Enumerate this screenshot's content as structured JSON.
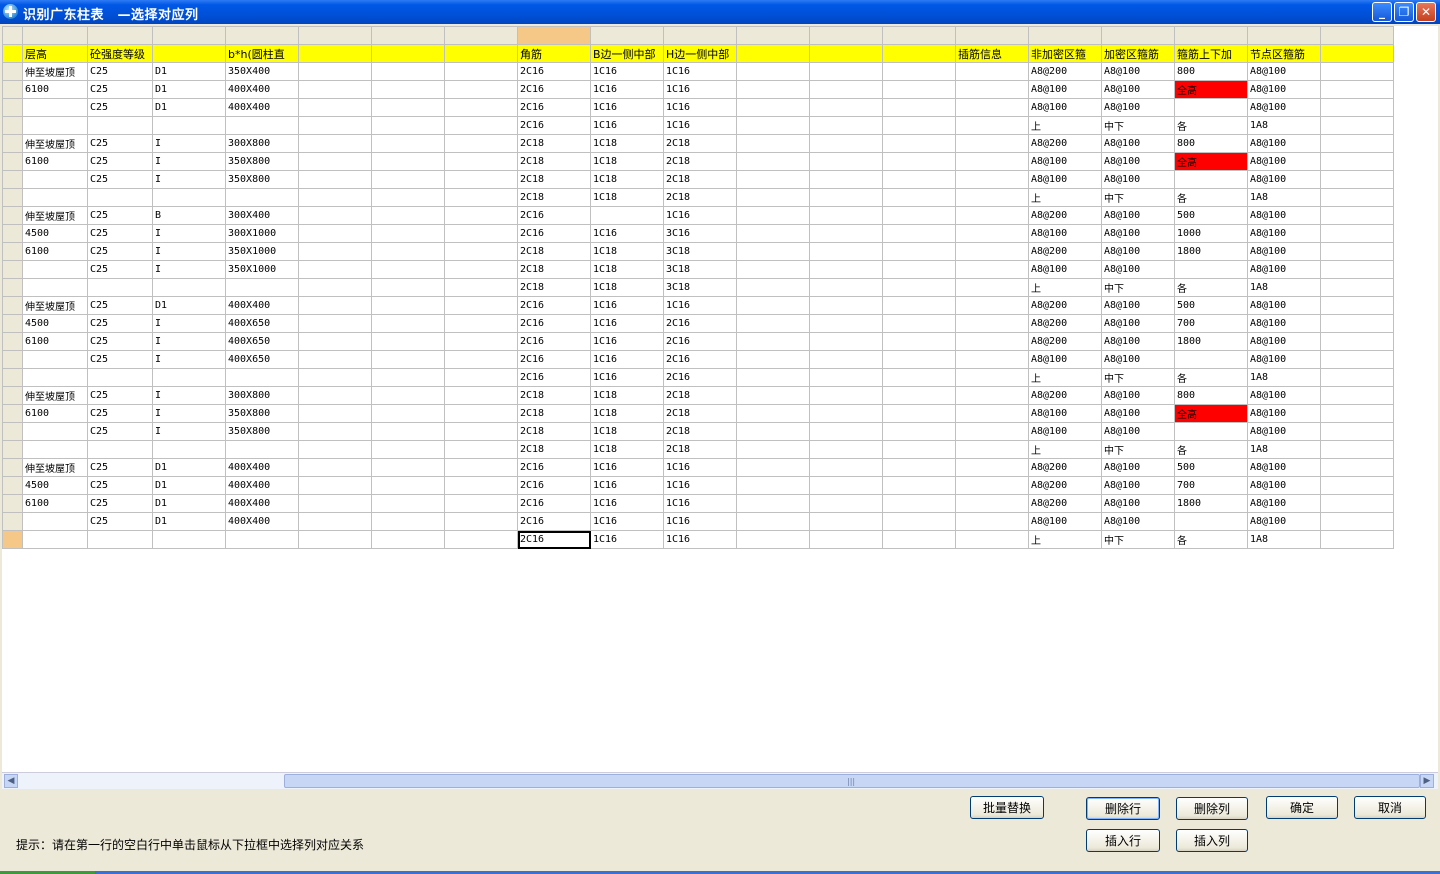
{
  "window": {
    "title": "识别广东柱表　—选择对应列",
    "minimize": "_",
    "restore": "❐",
    "close": "✕"
  },
  "grid": {
    "column_widths": [
      20,
      65,
      65,
      73,
      73,
      73,
      73,
      73,
      73,
      73,
      73,
      73,
      73,
      73,
      73,
      73,
      73,
      73,
      73,
      73
    ],
    "header": [
      "层高",
      "砼强度等级",
      "",
      "b*h(圆柱直",
      "",
      "",
      "",
      "角筋",
      "B边一侧中部",
      "H边一侧中部",
      "",
      "",
      "",
      "插筋信息",
      "非加密区箍",
      "加密区箍筋",
      "箍筋上下加",
      "节点区箍筋",
      ""
    ],
    "rows": [
      [
        "伸至坡屋顶",
        "C25",
        "D1",
        "350X400",
        "",
        "",
        "",
        "2C16",
        "1C16",
        "1C16",
        "",
        "",
        "",
        "",
        "A8@200",
        "A8@100",
        "800",
        "A8@100",
        ""
      ],
      [
        "6100",
        "C25",
        "D1",
        "400X400",
        "",
        "",
        "",
        "2C16",
        "1C16",
        "1C16",
        "",
        "",
        "",
        "",
        "A8@100",
        "A8@100",
        "全高",
        "A8@100",
        ""
      ],
      [
        "",
        "C25",
        "D1",
        "400X400",
        "",
        "",
        "",
        "2C16",
        "1C16",
        "1C16",
        "",
        "",
        "",
        "",
        "A8@100",
        "A8@100",
        "",
        "A8@100",
        ""
      ],
      [
        "",
        "",
        "",
        "",
        "",
        "",
        "",
        "2C16",
        "1C16",
        "1C16",
        "",
        "",
        "",
        "",
        "上",
        "中下",
        "各",
        "1A8",
        ""
      ],
      [
        "伸至坡屋顶",
        "C25",
        "I",
        "300X800",
        "",
        "",
        "",
        "2C18",
        "1C18",
        "2C18",
        "",
        "",
        "",
        "",
        "A8@200",
        "A8@100",
        "800",
        "A8@100",
        ""
      ],
      [
        "6100",
        "C25",
        "I",
        "350X800",
        "",
        "",
        "",
        "2C18",
        "1C18",
        "2C18",
        "",
        "",
        "",
        "",
        "A8@100",
        "A8@100",
        "全高",
        "A8@100",
        ""
      ],
      [
        "",
        "C25",
        "I",
        "350X800",
        "",
        "",
        "",
        "2C18",
        "1C18",
        "2C18",
        "",
        "",
        "",
        "",
        "A8@100",
        "A8@100",
        "",
        "A8@100",
        ""
      ],
      [
        "",
        "",
        "",
        "",
        "",
        "",
        "",
        "2C18",
        "1C18",
        "2C18",
        "",
        "",
        "",
        "",
        "上",
        "中下",
        "各",
        "1A8",
        ""
      ],
      [
        "伸至坡屋顶",
        "C25",
        "B",
        "300X400",
        "",
        "",
        "",
        "2C16",
        "",
        "1C16",
        "",
        "",
        "",
        "",
        "A8@200",
        "A8@100",
        "500",
        "A8@100",
        ""
      ],
      [
        "4500",
        "C25",
        "I",
        "300X1000",
        "",
        "",
        "",
        "2C16",
        "1C16",
        "3C16",
        "",
        "",
        "",
        "",
        "A8@100",
        "A8@100",
        "1000",
        "A8@100",
        ""
      ],
      [
        "6100",
        "C25",
        "I",
        "350X1000",
        "",
        "",
        "",
        "2C18",
        "1C18",
        "3C18",
        "",
        "",
        "",
        "",
        "A8@200",
        "A8@100",
        "1800",
        "A8@100",
        ""
      ],
      [
        "",
        "C25",
        "I",
        "350X1000",
        "",
        "",
        "",
        "2C18",
        "1C18",
        "3C18",
        "",
        "",
        "",
        "",
        "A8@100",
        "A8@100",
        "",
        "A8@100",
        ""
      ],
      [
        "",
        "",
        "",
        "",
        "",
        "",
        "",
        "2C18",
        "1C18",
        "3C18",
        "",
        "",
        "",
        "",
        "上",
        "中下",
        "各",
        "1A8",
        ""
      ],
      [
        "伸至坡屋顶",
        "C25",
        "D1",
        "400X400",
        "",
        "",
        "",
        "2C16",
        "1C16",
        "1C16",
        "",
        "",
        "",
        "",
        "A8@200",
        "A8@100",
        "500",
        "A8@100",
        ""
      ],
      [
        "4500",
        "C25",
        "I",
        "400X650",
        "",
        "",
        "",
        "2C16",
        "1C16",
        "2C16",
        "",
        "",
        "",
        "",
        "A8@200",
        "A8@100",
        "700",
        "A8@100",
        ""
      ],
      [
        "6100",
        "C25",
        "I",
        "400X650",
        "",
        "",
        "",
        "2C16",
        "1C16",
        "2C16",
        "",
        "",
        "",
        "",
        "A8@200",
        "A8@100",
        "1800",
        "A8@100",
        ""
      ],
      [
        "",
        "C25",
        "I",
        "400X650",
        "",
        "",
        "",
        "2C16",
        "1C16",
        "2C16",
        "",
        "",
        "",
        "",
        "A8@100",
        "A8@100",
        "",
        "A8@100",
        ""
      ],
      [
        "",
        "",
        "",
        "",
        "",
        "",
        "",
        "2C16",
        "1C16",
        "2C16",
        "",
        "",
        "",
        "",
        "上",
        "中下",
        "各",
        "1A8",
        ""
      ],
      [
        "伸至坡屋顶",
        "C25",
        "I",
        "300X800",
        "",
        "",
        "",
        "2C18",
        "1C18",
        "2C18",
        "",
        "",
        "",
        "",
        "A8@200",
        "A8@100",
        "800",
        "A8@100",
        ""
      ],
      [
        "6100",
        "C25",
        "I",
        "350X800",
        "",
        "",
        "",
        "2C18",
        "1C18",
        "2C18",
        "",
        "",
        "",
        "",
        "A8@100",
        "A8@100",
        "全高",
        "A8@100",
        ""
      ],
      [
        "",
        "C25",
        "I",
        "350X800",
        "",
        "",
        "",
        "2C18",
        "1C18",
        "2C18",
        "",
        "",
        "",
        "",
        "A8@100",
        "A8@100",
        "",
        "A8@100",
        ""
      ],
      [
        "",
        "",
        "",
        "",
        "",
        "",
        "",
        "2C18",
        "1C18",
        "2C18",
        "",
        "",
        "",
        "",
        "上",
        "中下",
        "各",
        "1A8",
        ""
      ],
      [
        "伸至坡屋顶",
        "C25",
        "D1",
        "400X400",
        "",
        "",
        "",
        "2C16",
        "1C16",
        "1C16",
        "",
        "",
        "",
        "",
        "A8@200",
        "A8@100",
        "500",
        "A8@100",
        ""
      ],
      [
        "4500",
        "C25",
        "D1",
        "400X400",
        "",
        "",
        "",
        "2C16",
        "1C16",
        "1C16",
        "",
        "",
        "",
        "",
        "A8@200",
        "A8@100",
        "700",
        "A8@100",
        ""
      ],
      [
        "6100",
        "C25",
        "D1",
        "400X400",
        "",
        "",
        "",
        "2C16",
        "1C16",
        "1C16",
        "",
        "",
        "",
        "",
        "A8@200",
        "A8@100",
        "1800",
        "A8@100",
        ""
      ],
      [
        "",
        "C25",
        "D1",
        "400X400",
        "",
        "",
        "",
        "2C16",
        "1C16",
        "1C16",
        "",
        "",
        "",
        "",
        "A8@100",
        "A8@100",
        "",
        "A8@100",
        ""
      ],
      [
        "",
        "",
        "",
        "",
        "",
        "",
        "",
        "2C16",
        "1C16",
        "1C16",
        "",
        "",
        "",
        "",
        "上",
        "中下",
        "各",
        "1A8",
        ""
      ]
    ],
    "highlight_value": "全高",
    "highlight_color": "#ff0000",
    "header_color": "#ffff00",
    "selected_column_color": "#f5c888"
  },
  "buttons": {
    "batch_replace": "批量替换",
    "delete_row": "删除行",
    "delete_column": "删除列",
    "ok": "确定",
    "cancel": "取消",
    "insert_row": "插入行",
    "insert_column": "插入列"
  },
  "hint": "提示：请在第一行的空白行中单击鼠标从下拉框中选择列对应关系"
}
